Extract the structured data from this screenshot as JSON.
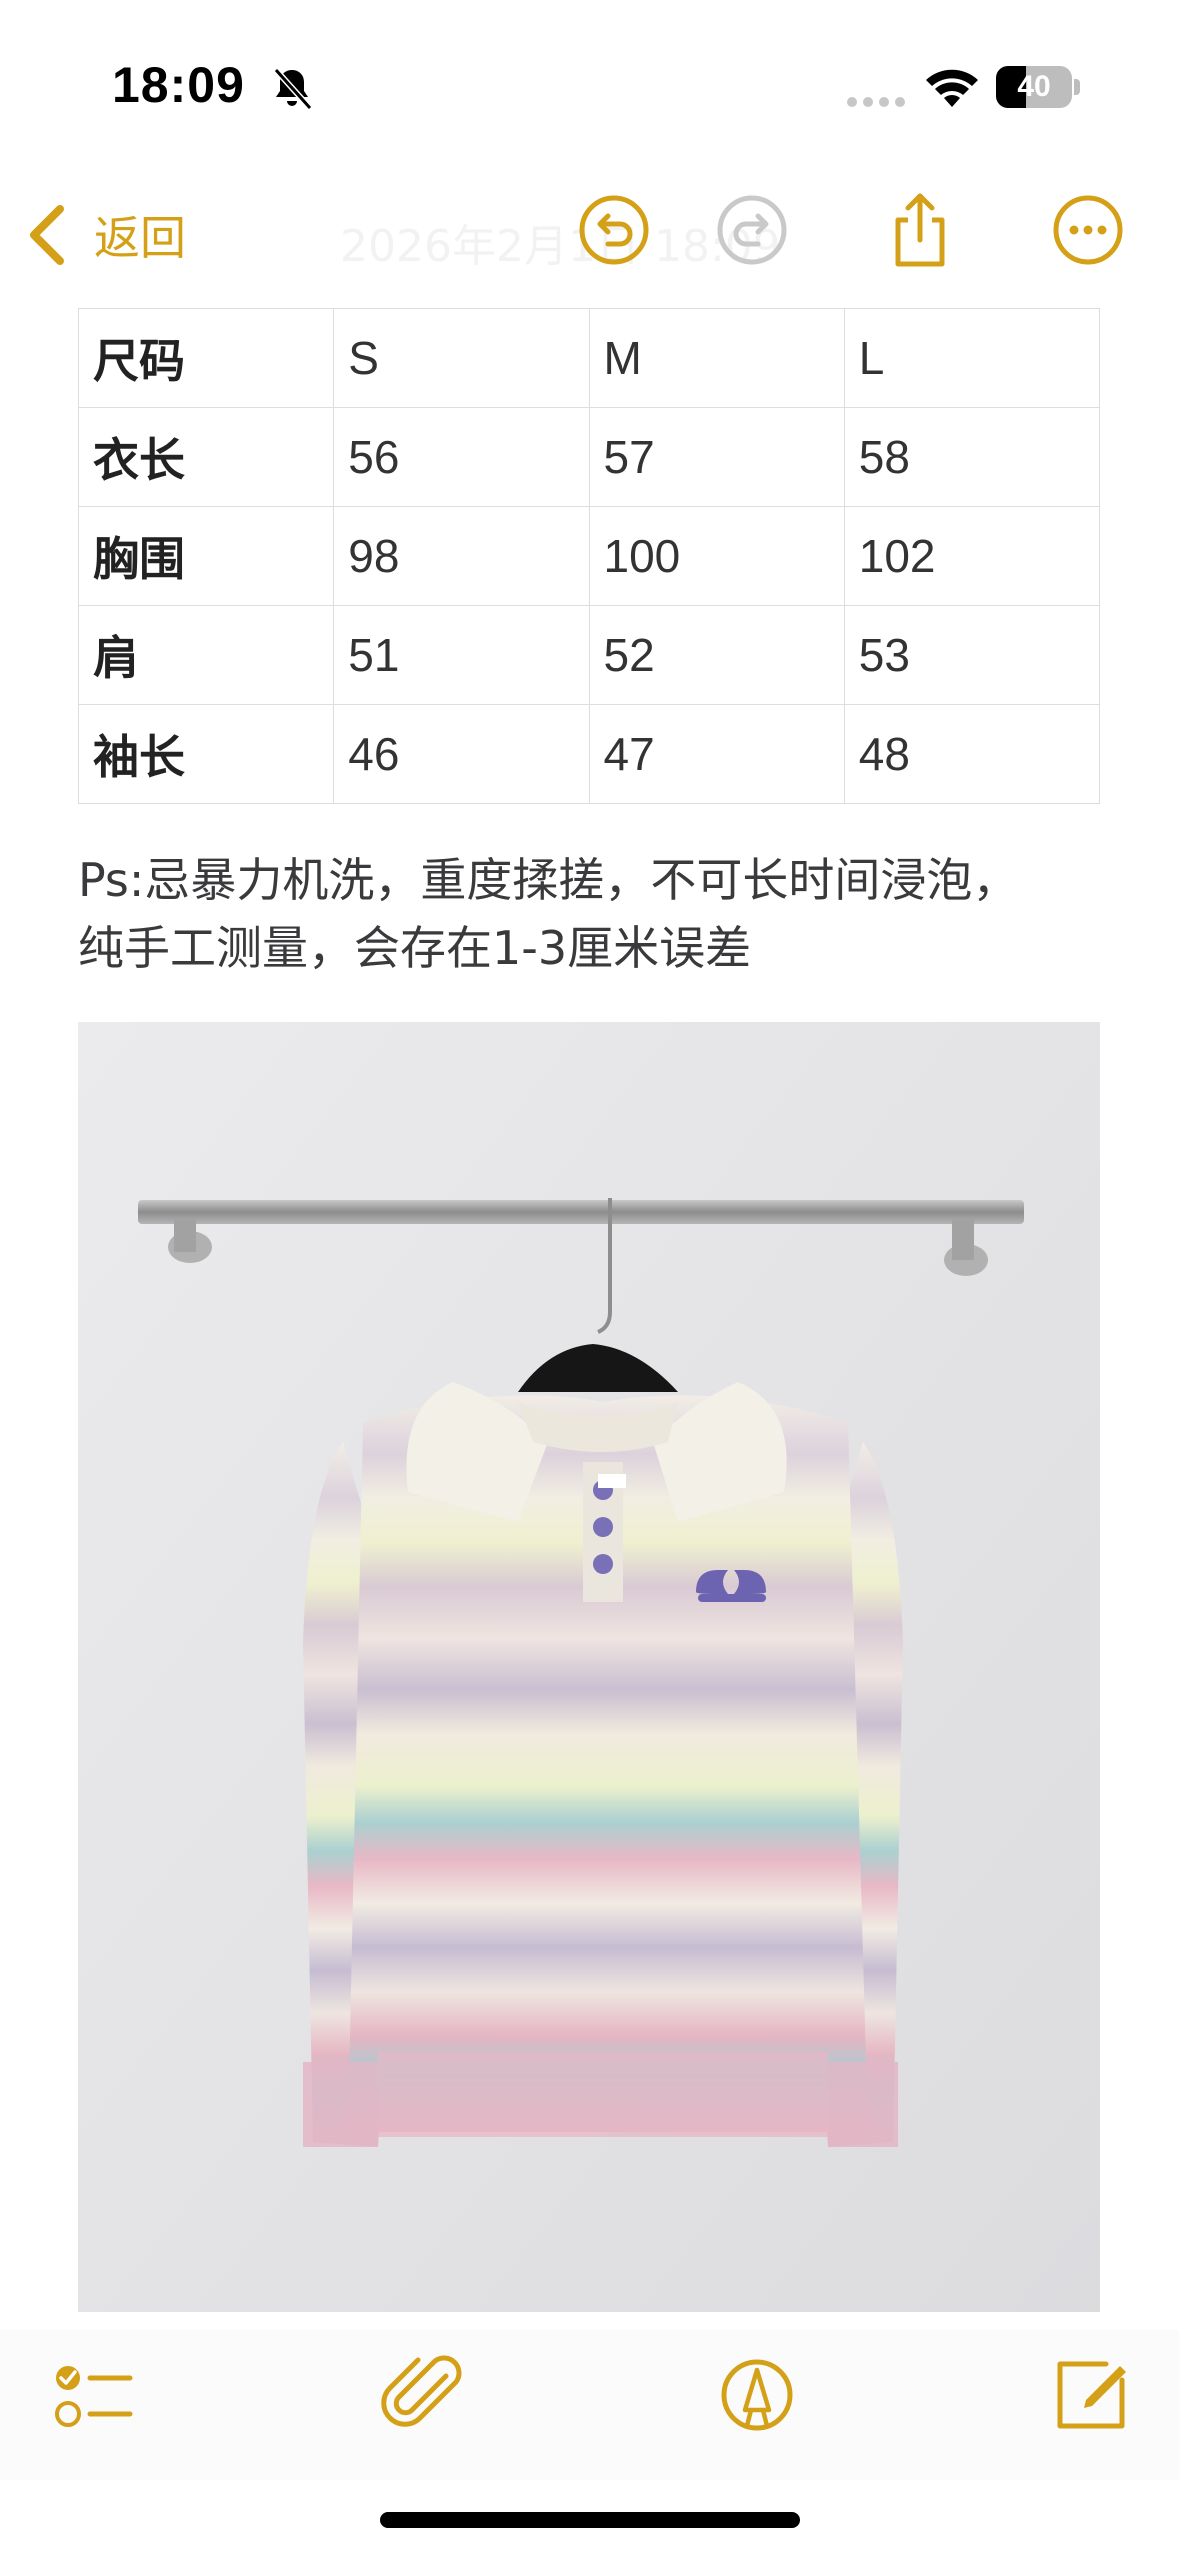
{
  "status_bar": {
    "time": "18:09",
    "battery_level": "40",
    "battery_fraction": 0.4,
    "icons": [
      "bell-slash-icon",
      "cellular-signal-icon",
      "wifi-icon",
      "battery-icon"
    ]
  },
  "nav": {
    "back_label": "返回",
    "title": "2026年2月1日 18:09",
    "accent_color": "#d4a017",
    "icons": [
      "chevron-left-icon",
      "undo-icon",
      "redo-icon",
      "share-icon",
      "more-icon"
    ]
  },
  "size_table": {
    "header": [
      "尺码",
      "S",
      "M",
      "L"
    ],
    "rows": [
      [
        "衣长",
        "56",
        "57",
        "58"
      ],
      [
        "胸围",
        "98",
        "100",
        "102"
      ],
      [
        "肩",
        "51",
        "52",
        "53"
      ],
      [
        "袖长",
        "46",
        "47",
        "48"
      ]
    ]
  },
  "note": {
    "line1": "Ps:忌暴力机洗，重度揉搓，不可长时间浸泡，",
    "line2": "纯手工测量，会存在1-3厘米误差"
  },
  "photo": {
    "description_icon": "sweater-photo",
    "colors": {
      "wall": "#e6e6e8",
      "rail": "#9a9a9a",
      "knit_base": "#efe8e4",
      "stripe_pink": "#e7b7c4",
      "stripe_lilac": "#c7bcd0",
      "stripe_teal": "#a9cfd0",
      "stripe_yellow": "#edefc6",
      "logo": "#6c64b0"
    }
  },
  "toolbar": {
    "icons": [
      "checklist-icon",
      "paperclip-icon",
      "markup-pen-icon",
      "compose-icon"
    ]
  }
}
